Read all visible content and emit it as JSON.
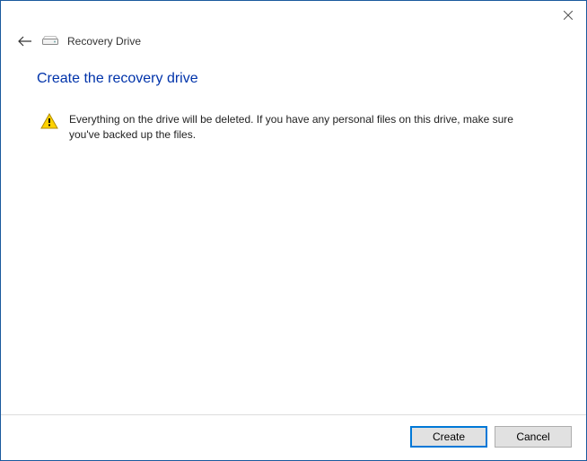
{
  "titlebar": {
    "close_label": "Close"
  },
  "header": {
    "title": "Recovery Drive"
  },
  "content": {
    "heading": "Create the recovery drive",
    "warning_text": "Everything on the drive will be deleted. If you have any personal files on this drive, make sure you've backed up the files."
  },
  "footer": {
    "create_label": "Create",
    "cancel_label": "Cancel"
  }
}
